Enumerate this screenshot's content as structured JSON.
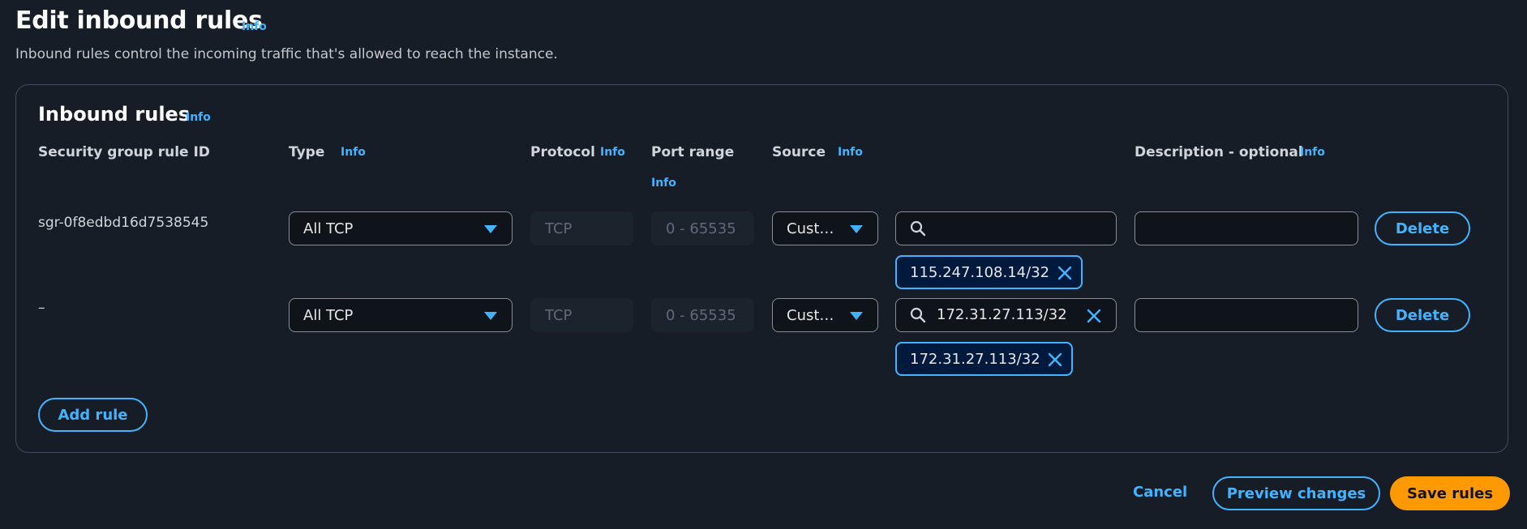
{
  "page": {
    "title": "Edit inbound rules",
    "info": "Info",
    "description": "Inbound rules control the incoming traffic that's allowed to reach the instance."
  },
  "panel": {
    "title": "Inbound rules",
    "info": "Info",
    "columns": {
      "rule_id": "Security group rule ID",
      "type": "Type",
      "protocol": "Protocol",
      "port_range": "Port range",
      "source": "Source",
      "description": "Description - optional",
      "info": "Info"
    },
    "rows": [
      {
        "rule_id": "sgr-0f8edbd16d7538545",
        "type": "All TCP",
        "protocol": "TCP",
        "port_range": "0 - 65535",
        "source_type": "Cust…",
        "search_value": "",
        "token": "115.247.108.14/32",
        "description": "",
        "delete_label": "Delete"
      },
      {
        "rule_id": "–",
        "type": "All TCP",
        "protocol": "TCP",
        "port_range": "0 - 65535",
        "source_type": "Cust…",
        "search_value": "172.31.27.113/32",
        "token": "172.31.27.113/32",
        "description": "",
        "delete_label": "Delete"
      }
    ],
    "add_rule": "Add rule"
  },
  "footer": {
    "cancel": "Cancel",
    "preview": "Preview changes",
    "save": "Save rules"
  },
  "colors": {
    "background": "#161d26",
    "accent": "#42b4ff",
    "primary_button": "#ff9900"
  },
  "icons": {
    "dropdown": "caret-down-icon",
    "search": "search-icon",
    "remove": "close-icon"
  }
}
